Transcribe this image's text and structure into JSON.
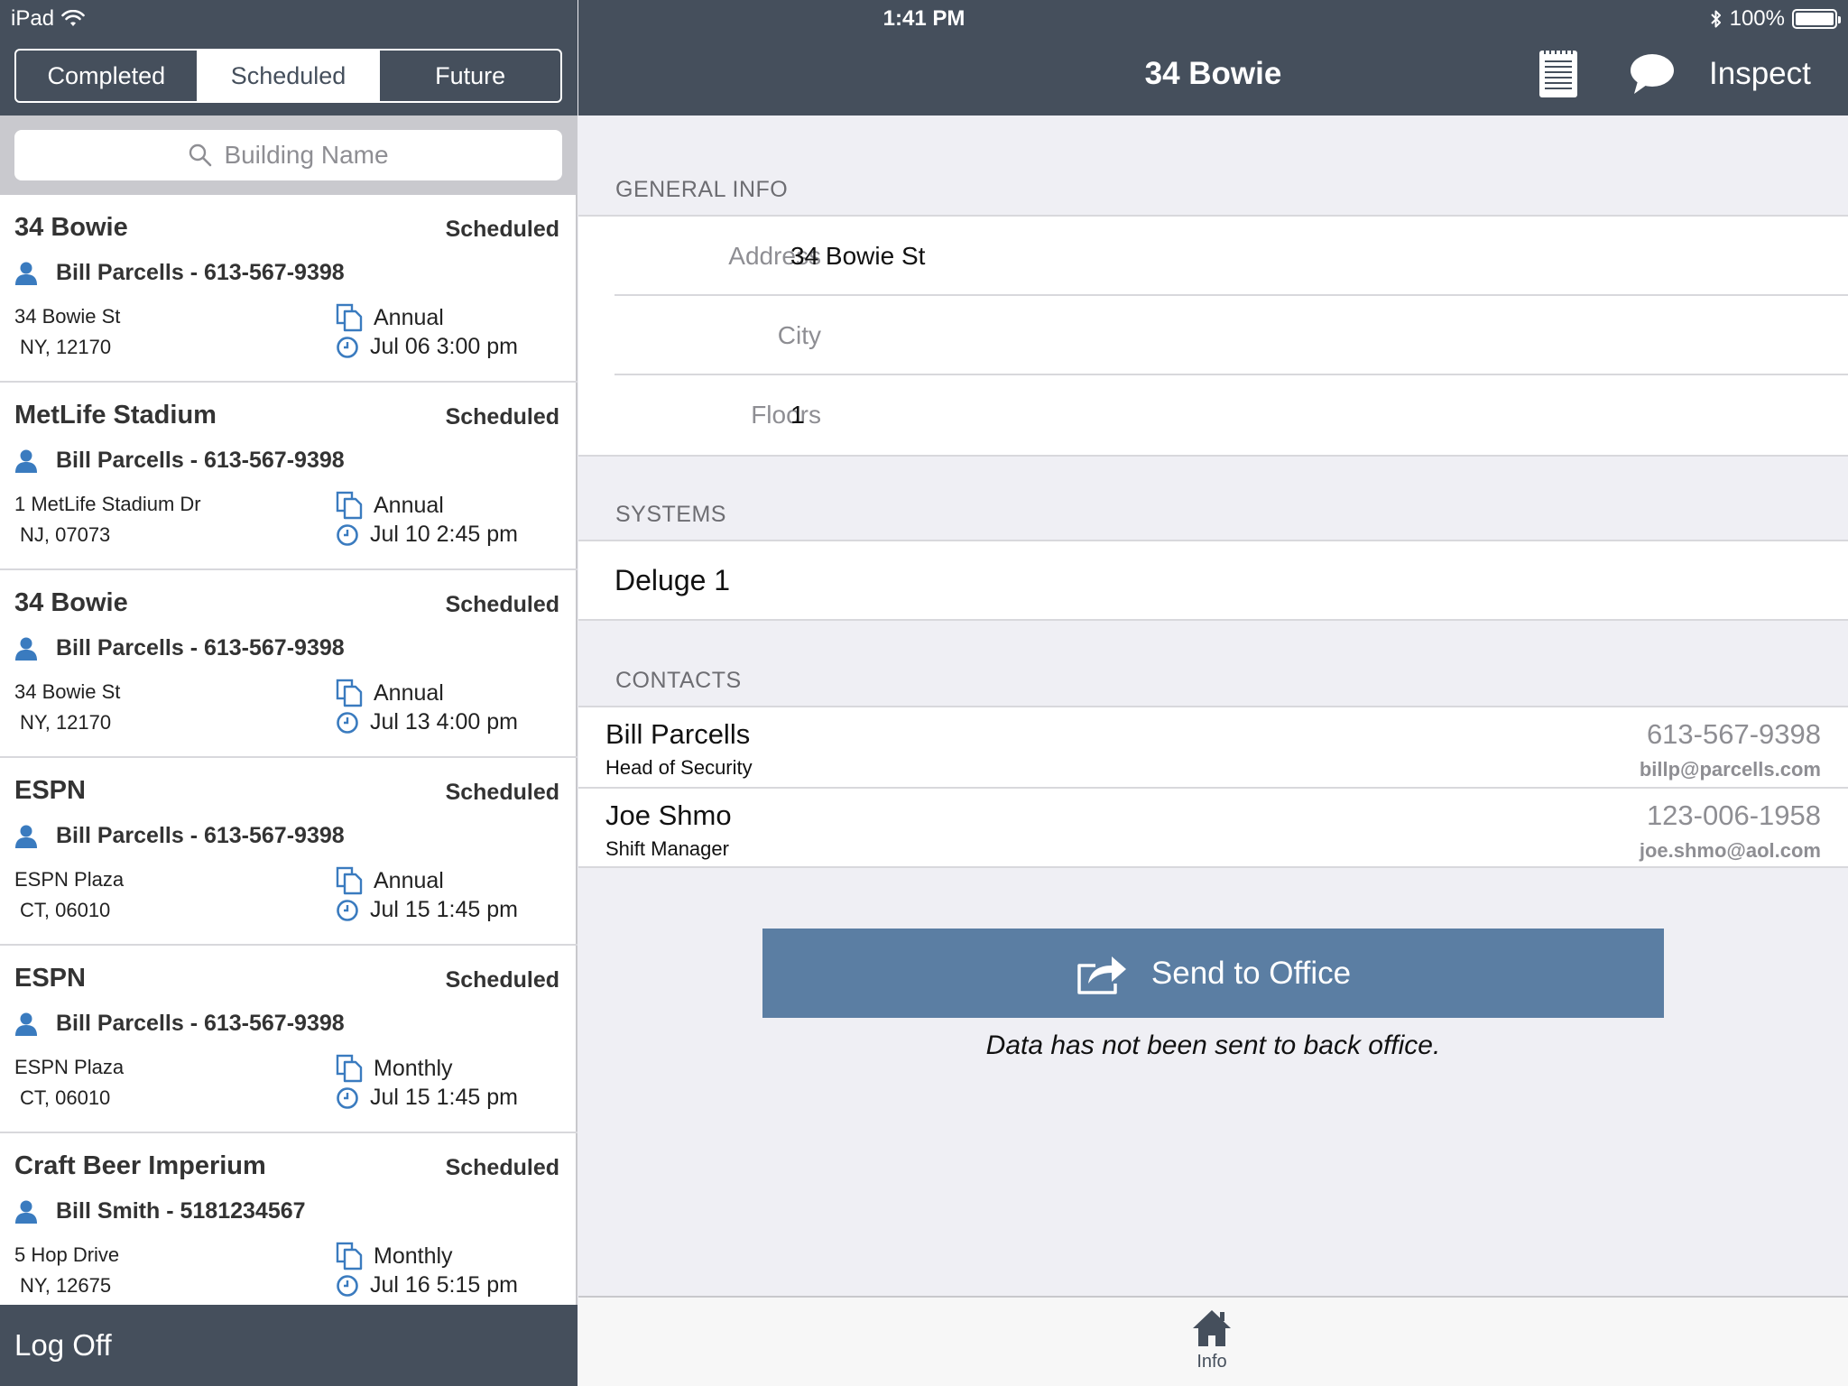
{
  "status_bar": {
    "device": "iPad",
    "time": "1:41 PM",
    "battery": "100%"
  },
  "left_panel": {
    "segments": [
      "Completed",
      "Scheduled",
      "Future"
    ],
    "active_segment": "Scheduled",
    "search": {
      "placeholder": "Building Name"
    },
    "items": [
      {
        "name": "34 Bowie",
        "status": "Scheduled",
        "contact": "Bill Parcells - 613-567-9398",
        "address1": "34 Bowie St",
        "address2": "NY, 12170",
        "frequency": "Annual",
        "datetime": "Jul 06 3:00 pm"
      },
      {
        "name": "MetLife Stadium",
        "status": "Scheduled",
        "contact": "Bill Parcells - 613-567-9398",
        "address1": "1 MetLife Stadium Dr",
        "address2": "NJ, 07073",
        "frequency": "Annual",
        "datetime": "Jul 10 2:45 pm"
      },
      {
        "name": "34 Bowie",
        "status": "Scheduled",
        "contact": "Bill Parcells - 613-567-9398",
        "address1": "34 Bowie St",
        "address2": "NY, 12170",
        "frequency": "Annual",
        "datetime": "Jul 13 4:00 pm"
      },
      {
        "name": "ESPN",
        "status": "Scheduled",
        "contact": "Bill Parcells - 613-567-9398",
        "address1": "ESPN Plaza",
        "address2": "CT, 06010",
        "frequency": "Annual",
        "datetime": "Jul 15 1:45 pm"
      },
      {
        "name": "ESPN",
        "status": "Scheduled",
        "contact": "Bill Parcells - 613-567-9398",
        "address1": "ESPN Plaza",
        "address2": "CT, 06010",
        "frequency": "Monthly",
        "datetime": "Jul 15 1:45 pm"
      },
      {
        "name": "Craft Beer Imperium",
        "status": "Scheduled",
        "contact": "Bill Smith - 5181234567",
        "address1": "5 Hop Drive",
        "address2": "NY, 12675",
        "frequency": "Monthly",
        "datetime": "Jul 16 5:15 pm"
      }
    ],
    "logoff_label": "Log Off"
  },
  "detail": {
    "title": "34 Bowie",
    "inspect_label": "Inspect",
    "general_info": {
      "heading": "GENERAL INFO",
      "fields": [
        {
          "label": "Address",
          "value": "34 Bowie St"
        },
        {
          "label": "City",
          "value": ""
        },
        {
          "label": "Floors",
          "value": "1"
        }
      ]
    },
    "systems": {
      "heading": "SYSTEMS",
      "items": [
        "Deluge 1"
      ]
    },
    "contacts": {
      "heading": "CONTACTS",
      "items": [
        {
          "name": "Bill Parcells",
          "role": "Head of Security",
          "phone": "613-567-9398",
          "email": "billp@parcells.com"
        },
        {
          "name": "Joe Shmo",
          "role": "Shift Manager",
          "phone": "123-006-1958",
          "email": "joe.shmo@aol.com"
        }
      ]
    },
    "send_button_label": "Send to Office",
    "send_status": "Data has not been sent to back office."
  },
  "tabbar": {
    "info_label": "Info"
  },
  "colors": {
    "header": "#454f5c",
    "accent_button": "#5b7ea3",
    "contact_icon": "#3a7bbf"
  }
}
